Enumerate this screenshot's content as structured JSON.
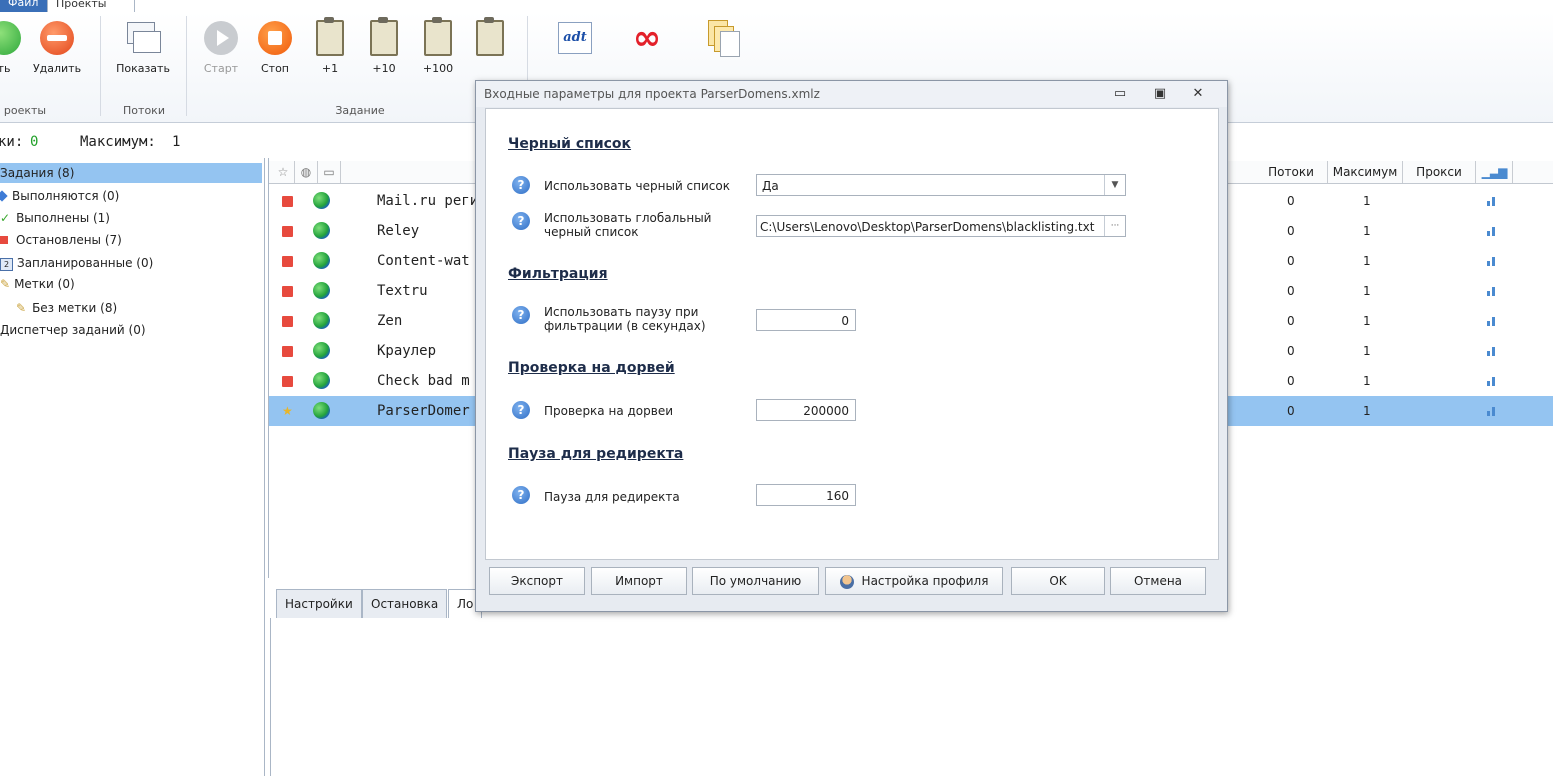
{
  "ribbon": {
    "tabs": [
      "Файл",
      "Проекты"
    ],
    "buttons": {
      "add": "ть",
      "delete": "Удалить",
      "show": "Показать",
      "start": "Старт",
      "stop": "Стоп",
      "plus1": "+1",
      "plus10": "+10",
      "plus100": "+100"
    },
    "groups": {
      "projects": "роекты",
      "threads": "Потоки",
      "task": "Задание"
    }
  },
  "stats": {
    "threads_label": "ки:",
    "threads_value": "0",
    "max_label": "Максимум:",
    "max_value": "1"
  },
  "tree": {
    "root": "Задания (8)",
    "running": "Выполняются (0)",
    "done": "Выполнены (1)",
    "stopped": "Остановлены (7)",
    "scheduled": "Запланированные (0)",
    "tags": "Метки (0)",
    "no_tag": "Без метки (8)",
    "dispatcher": "Диспетчер заданий (0)"
  },
  "grid": {
    "columns": {
      "threads": "Потоки",
      "max": "Максимум",
      "proxy": "Прокси"
    },
    "rows": [
      {
        "name": "Mail.ru регис",
        "threads": "0",
        "max": "1"
      },
      {
        "name": "Reley",
        "threads": "0",
        "max": "1"
      },
      {
        "name": "Content-wat",
        "threads": "0",
        "max": "1"
      },
      {
        "name": "Textru",
        "threads": "0",
        "max": "1"
      },
      {
        "name": "Zen",
        "threads": "0",
        "max": "1"
      },
      {
        "name": "Краулер",
        "threads": "0",
        "max": "1"
      },
      {
        "name": "Check bad m",
        "threads": "0",
        "max": "1"
      },
      {
        "name": "ParserDomer",
        "threads": "0",
        "max": "1"
      }
    ]
  },
  "bottom_tabs": [
    "Настройки",
    "Остановка",
    "Ло"
  ],
  "dialog": {
    "title": "Входные параметры для проекта ParserDomens.xmlz",
    "sections": {
      "blacklist": "Черный список",
      "filter": "Фильтрация",
      "doorway": "Проверка на дорвей",
      "redirect": "Пауза для редиректа"
    },
    "params": {
      "use_blacklist_label": "Использовать черный список",
      "use_blacklist_value": "Да",
      "global_blacklist_label_1": "Использовать глобальный",
      "global_blacklist_label_2": "черный список",
      "global_blacklist_value": "C:\\Users\\Lenovo\\Desktop\\ParserDomens\\blacklisting.txt",
      "filter_pause_label_1": "Использовать паузу при",
      "filter_pause_label_2": "фильтрации (в секундах)",
      "filter_pause_value": "0",
      "doorway_label": "Проверка на дорвеи",
      "doorway_value": "200000",
      "redirect_label": "Пауза для редиректа",
      "redirect_value": "160"
    },
    "buttons": {
      "export": "Экспорт",
      "import": "Импорт",
      "default": "По умолчанию",
      "profile": "Настройка профиля",
      "ok": "OK",
      "cancel": "Отмена"
    },
    "browse": "···"
  }
}
